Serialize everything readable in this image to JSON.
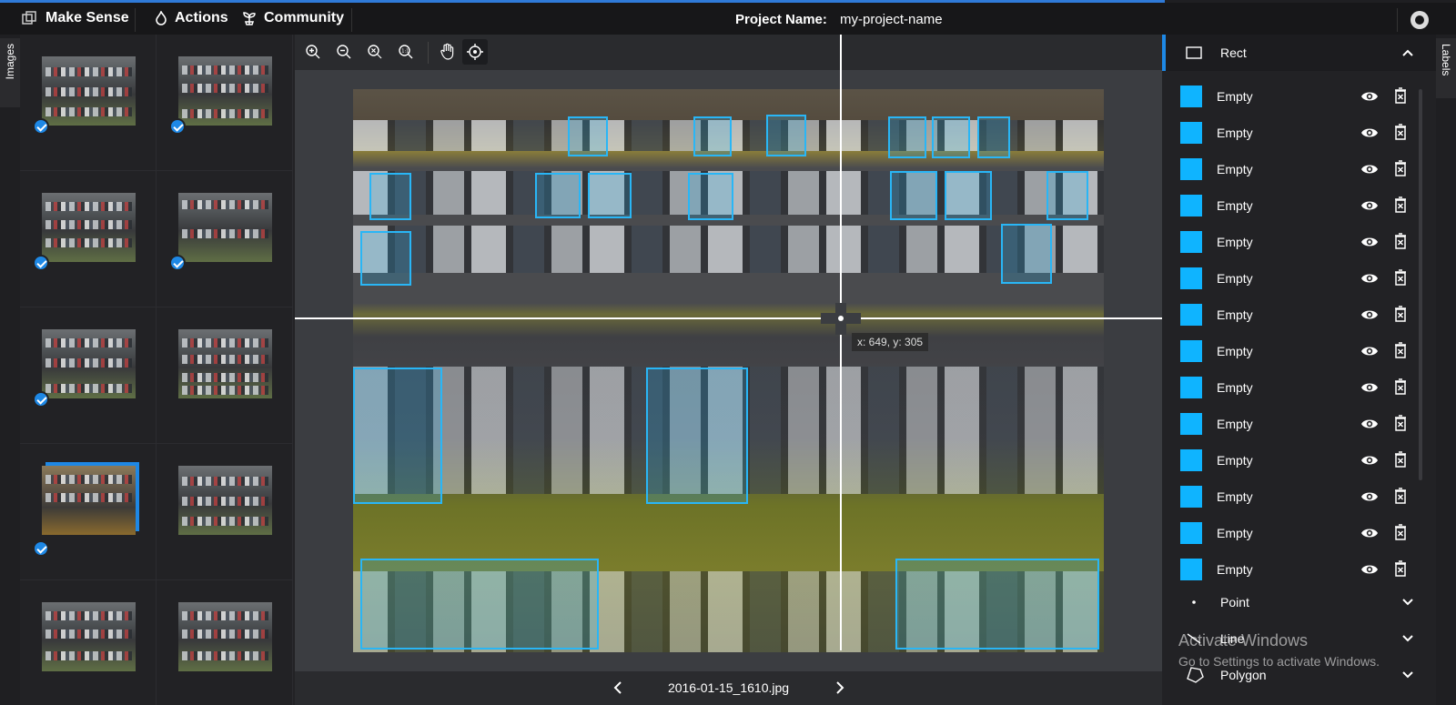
{
  "header": {
    "brand": "Make Sense",
    "nav": [
      "Actions",
      "Community"
    ],
    "project_label": "Project Name:",
    "project_name": "my-project-name"
  },
  "side_tabs": {
    "left": "Images",
    "right": "Labels"
  },
  "thumbnails": {
    "count": 10,
    "checked": [
      true,
      true,
      true,
      true,
      true,
      false,
      true,
      false,
      false,
      false
    ],
    "selected_index": 6
  },
  "editor": {
    "tools": [
      "zoom-in-icon",
      "zoom-out-icon",
      "zoom-fit-icon",
      "zoom-reset-icon",
      "pan-hand-icon",
      "crosshair-icon"
    ],
    "active_tool": "crosshair-icon",
    "cursor_readout": "x: 649, y: 305",
    "filename": "2016-01-15_1610.jpg",
    "bbox_color": "#29b6f6"
  },
  "labels_panel": {
    "rect": {
      "title": "Rect",
      "expanded": true
    },
    "items": [
      "Empty",
      "Empty",
      "Empty",
      "Empty",
      "Empty",
      "Empty",
      "Empty",
      "Empty",
      "Empty",
      "Empty",
      "Empty",
      "Empty",
      "Empty",
      "Empty"
    ],
    "swatch_color": "#0fb4ff",
    "point": {
      "title": "Point"
    },
    "line": {
      "title": "Line"
    },
    "polygon": {
      "title": "Polygon"
    }
  },
  "os_overlay": {
    "title": "Activate Windows",
    "subtitle": "Go to Settings to activate Windows."
  }
}
